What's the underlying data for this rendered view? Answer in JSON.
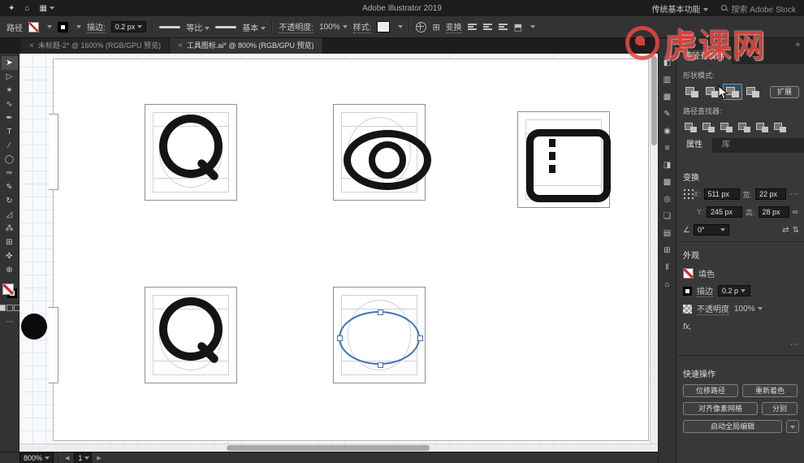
{
  "colors": {
    "accent_blue": "#31a8ff",
    "watermark_red": "#e8463f",
    "selection_blue": "#4272b8",
    "icon_black": "#141414"
  },
  "icons": {
    "caret": "∨",
    "more": "⋯",
    "collapse": "«",
    "close": "×",
    "home": "⌂",
    "app": "✦",
    "menu": "▦",
    "angle": "∠",
    "flip_h": "⇄",
    "flip_v": "⇅",
    "chain": "∞",
    "prev": "◀",
    "next": "▶",
    "grid": "⊞"
  },
  "menubar": {
    "app_title": "Adobe Illustrator 2019",
    "workspace": "传统基本功能",
    "search_placeholder": "搜索 Adobe Stock"
  },
  "controlbar": {
    "object_label": "路径",
    "stroke_label": "描边:",
    "stroke_value": "0.2 px",
    "profile_value": "等比",
    "brush_value": "基本",
    "opacity_label": "不透明度:",
    "opacity_value": "100%",
    "style_label": "样式:",
    "transform_label": "变换"
  },
  "tabbar": {
    "tabs": [
      {
        "title": "未标题-2* @ 1600% (RGB/GPU 预览)"
      },
      {
        "title": "工具图标.ai* @ 800% (RGB/GPU 预览)"
      }
    ]
  },
  "toolbar": {
    "tools": [
      {
        "name": "selection-tool",
        "glyph": "➤",
        "active": true
      },
      {
        "name": "direct-selection-tool",
        "glyph": "▷"
      },
      {
        "name": "magic-wand-tool",
        "glyph": "✶"
      },
      {
        "name": "lasso-tool",
        "glyph": "∿"
      },
      {
        "name": "pen-tool",
        "glyph": "✒"
      },
      {
        "name": "type-tool",
        "glyph": "T"
      },
      {
        "name": "line-segment-tool",
        "glyph": "∕"
      },
      {
        "name": "ellipse-tool",
        "glyph": "◯"
      },
      {
        "name": "paintbrush-tool",
        "glyph": "✑"
      },
      {
        "name": "pencil-tool",
        "glyph": "✎"
      },
      {
        "name": "rotate-tool",
        "glyph": "↻"
      },
      {
        "name": "scale-tool",
        "glyph": "◿"
      },
      {
        "name": "symbol-sprayer-tool",
        "glyph": "⁂"
      },
      {
        "name": "artboard-tool",
        "glyph": "⊞"
      },
      {
        "name": "hand-tool",
        "glyph": "✜"
      },
      {
        "name": "zoom-tool",
        "glyph": "⊕"
      }
    ]
  },
  "right_strip": {
    "icons": [
      {
        "name": "color-panel-icon",
        "glyph": "◧"
      },
      {
        "name": "color-guide-panel-icon",
        "glyph": "▥"
      },
      {
        "name": "swatches-panel-icon",
        "glyph": "▦"
      },
      {
        "name": "brushes-panel-icon",
        "glyph": "✎"
      },
      {
        "name": "symbols-panel-icon",
        "glyph": "◉"
      },
      {
        "name": "stroke-panel-icon",
        "glyph": "≡"
      },
      {
        "name": "gradient-panel-icon",
        "glyph": "◨"
      },
      {
        "name": "transparency-panel-icon",
        "glyph": "▩"
      },
      {
        "name": "appearance-panel-icon",
        "glyph": "◎"
      },
      {
        "name": "graphic-styles-panel-icon",
        "glyph": "❏"
      },
      {
        "name": "layers-panel-icon",
        "glyph": "▤"
      },
      {
        "name": "artboards-panel-icon",
        "glyph": "⊞"
      },
      {
        "name": "align-panel-icon",
        "glyph": "‖"
      },
      {
        "name": "libraries-panel-icon",
        "glyph": "⌂"
      }
    ]
  },
  "pathfinder_panel": {
    "tab_title": "路径查找器",
    "shape_modes_label": "形状模式:",
    "expand_button": "扩展",
    "pathfinder_label": "路径查找器:",
    "shape_modes": [
      {
        "name": "shape-mode-unite-button"
      },
      {
        "name": "shape-mode-minus-front-button"
      },
      {
        "name": "shape-mode-intersect-button",
        "active": true
      },
      {
        "name": "shape-mode-exclude-button"
      }
    ],
    "pathfinder_modes": [
      {
        "name": "pathfinder-divide-button"
      },
      {
        "name": "pathfinder-trim-button"
      },
      {
        "name": "pathfinder-merge-button"
      },
      {
        "name": "pathfinder-crop-button"
      },
      {
        "name": "pathfinder-outline-button"
      },
      {
        "name": "pathfinder-minus-back-button"
      }
    ]
  },
  "properties_panel": {
    "tabs": {
      "properties": "属性",
      "libraries": "库"
    },
    "transform": {
      "title": "变换",
      "x_label": "X:",
      "x_value": "511 px",
      "y_label": "Y:",
      "y_value": "245 px",
      "w_label": "宽:",
      "w_value": "22 px",
      "h_label": "高:",
      "h_value": "28 px",
      "angle_value": "0°"
    },
    "appearance": {
      "title": "外观",
      "fill_label": "填色",
      "stroke_label": "描边",
      "stroke_value": "0.2 p",
      "opacity_label": "不透明度",
      "opacity_value": "100%",
      "fx_label": "fx,"
    },
    "quick_actions": {
      "title": "快速操作",
      "offset_path": "位移路径",
      "recolor": "重新着色",
      "align_pixel_grid": "对齐像素网格",
      "separate": "分别",
      "global_edit": "启动全局编辑"
    }
  },
  "statusbar": {
    "zoom": "800%",
    "artboard_number": "1"
  },
  "watermark": {
    "text": "虎课网"
  }
}
